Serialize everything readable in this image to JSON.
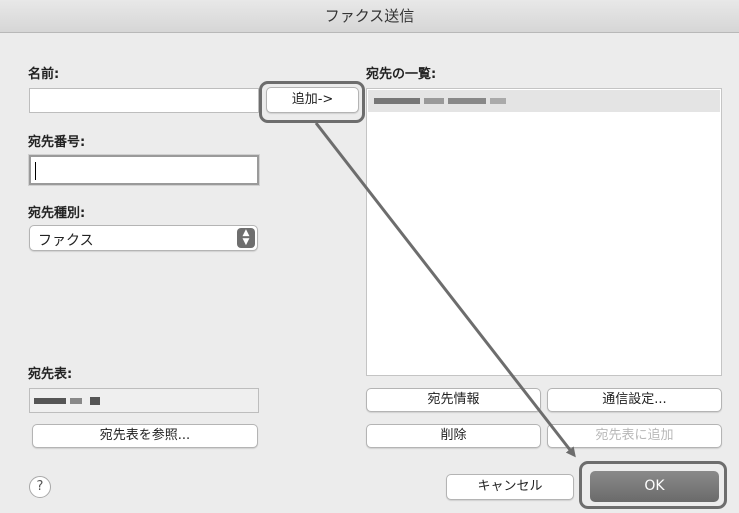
{
  "window": {
    "title": "ファクス送信"
  },
  "left": {
    "name_label": "名前:",
    "name_value": "",
    "number_label": "宛先番号:",
    "number_value": "",
    "type_label": "宛先種別:",
    "type_value": "ファクス",
    "addressbook_label": "宛先表:",
    "browse_button": "宛先表を参照..."
  },
  "add_button": "追加->",
  "right": {
    "list_label": "宛先の一覧:",
    "info_button": "宛先情報",
    "comm_settings_button": "通信設定...",
    "delete_button": "削除",
    "add_to_book_button": "宛先表に追加"
  },
  "footer": {
    "help": "?",
    "cancel_button": "キャンセル",
    "ok_button": "OK"
  },
  "colors": {
    "highlight": "#6d6d6d",
    "ok_bg": "#777777",
    "selected_row": "#e4e4e4"
  },
  "icons": {
    "stepper": "updown-chevron-icon",
    "help": "question-icon"
  }
}
